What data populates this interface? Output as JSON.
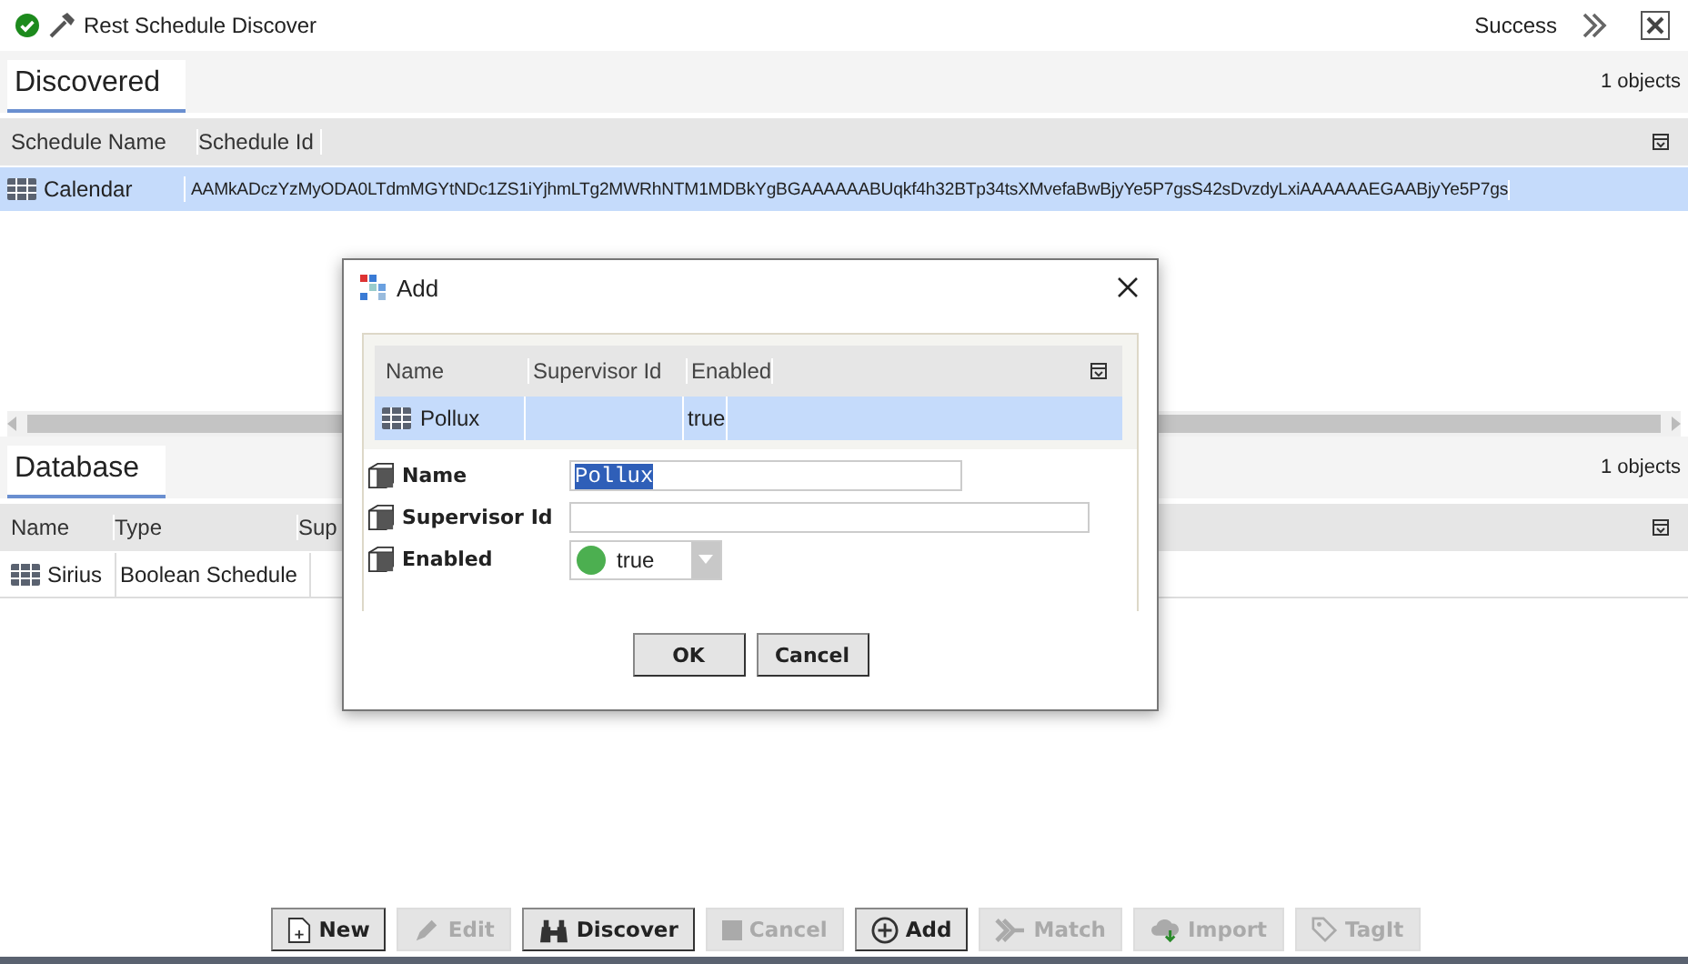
{
  "window": {
    "title": "Rest Schedule Discover",
    "status": "Success"
  },
  "discovered": {
    "tab": "Discovered",
    "count": "1 objects",
    "columns": [
      "Schedule Name",
      "Schedule Id"
    ],
    "rows": [
      {
        "name": "Calendar",
        "id": "AAMkADczYzMyODA0LTdmMGYtNDc1ZS1iYjhmLTg2MWRhNTM1MDBkYgBGAAAAAABUqkf4h32BTp34tsXMvefaBwBjyYe5P7gsS42sDvzdyLxiAAAAAAEGAABjyYe5P7gs",
        "selected": true
      }
    ]
  },
  "database": {
    "tab": "Database",
    "count": "1 objects",
    "columns": [
      "Name",
      "Type",
      "Sup"
    ],
    "rows": [
      {
        "name": "Sirius",
        "type": "Boolean Schedule",
        "selected": false
      }
    ]
  },
  "dialog": {
    "title": "Add",
    "columns": [
      "Name",
      "Supervisor Id",
      "Enabled"
    ],
    "rows": [
      {
        "name": "Pollux",
        "enabled": "true",
        "selected": true
      }
    ],
    "fields": [
      {
        "kind": "text",
        "label": "Name",
        "value": "Pollux",
        "highlighted": true
      },
      {
        "kind": "text",
        "label": "Supervisor Id"
      },
      {
        "kind": "select",
        "label": "Enabled",
        "value": "true"
      }
    ],
    "buttons": [
      "OK",
      "Cancel"
    ]
  },
  "buttons": [
    {
      "kind": "new",
      "label": "New",
      "disabled": false
    },
    {
      "kind": "edit",
      "label": "Edit",
      "disabled": true
    },
    {
      "kind": "discover",
      "label": "Discover",
      "disabled": false
    },
    {
      "kind": "cancel",
      "label": "Cancel",
      "disabled": true
    },
    {
      "kind": "add",
      "label": "Add",
      "disabled": false
    },
    {
      "kind": "match",
      "label": "Match",
      "disabled": true
    },
    {
      "kind": "import",
      "label": "Import",
      "disabled": true
    },
    {
      "kind": "tag",
      "label": "TagIt",
      "disabled": true
    }
  ]
}
